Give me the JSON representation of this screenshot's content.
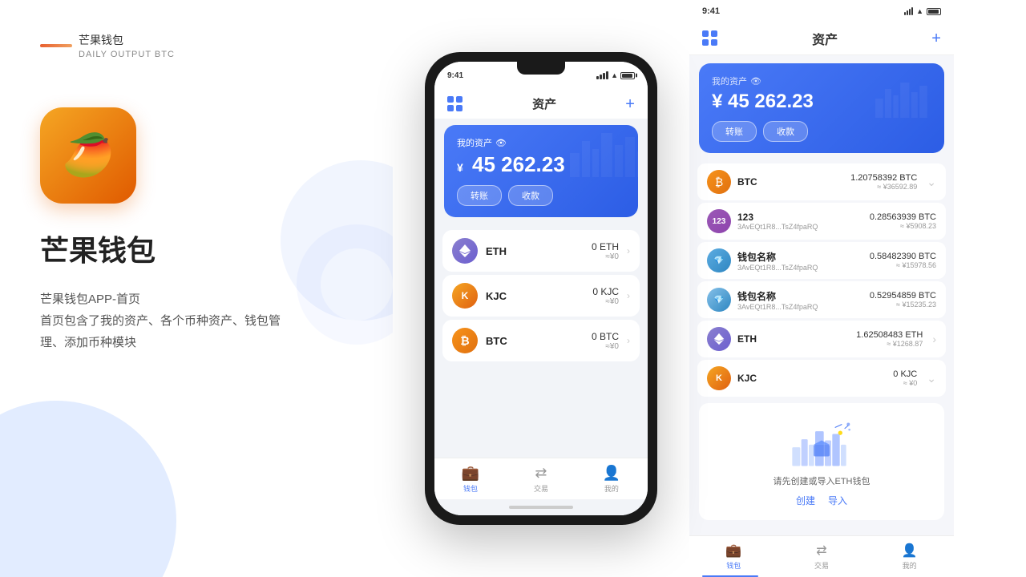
{
  "left": {
    "brand_line": "",
    "brand_name": "芒果钱包",
    "brand_sub": "DAILY OUTPUT BTC",
    "app_title": "芒果钱包",
    "app_desc_1": "芒果钱包APP-首页",
    "app_desc_2": "首页包含了我的资产、各个币种资产、钱包管",
    "app_desc_3": "理、添加币种模块"
  },
  "phone": {
    "status_time": "9:41",
    "header_title": "资产",
    "asset_label": "我的资产",
    "asset_amount": "45 262.23",
    "asset_cny": "¥",
    "btn_transfer": "转账",
    "btn_receive": "收款",
    "coins": [
      {
        "name": "ETH",
        "type": "eth",
        "amount": "0 ETH",
        "cny": "≈¥0",
        "symbol": "⬡"
      },
      {
        "name": "KJC",
        "type": "kjc",
        "amount": "0 KJC",
        "cny": "≈¥0",
        "symbol": "K"
      },
      {
        "name": "BTC",
        "type": "btc",
        "amount": "0 BTC",
        "cny": "≈¥0",
        "symbol": "₿"
      }
    ],
    "nav": [
      {
        "label": "钱包",
        "icon": "👜",
        "active": true
      },
      {
        "label": "交易",
        "icon": "⇄",
        "active": false
      },
      {
        "label": "我的",
        "icon": "👤",
        "active": false
      }
    ]
  },
  "right": {
    "status_time": "9:41",
    "header_title": "资产",
    "asset_label": "我的资产",
    "asset_amount": "45 262.23",
    "asset_cny": "¥",
    "btn_transfer": "转账",
    "btn_receive": "收款",
    "coins": [
      {
        "name": "BTC",
        "type": "btc",
        "amount_main": "1.20758392 BTC",
        "amount_cny": "≈ ¥36592.89",
        "addr": "",
        "has_addr": false
      },
      {
        "name": "123",
        "type": "custom",
        "amount_main": "0.28563939 BTC",
        "amount_cny": "≈ ¥5908.23",
        "addr": "3AvEQt1R8...TsZ4fpaRQ",
        "has_addr": true
      },
      {
        "name": "钱包名称",
        "type": "custom2",
        "amount_main": "0.58482390 BTC",
        "amount_cny": "≈ ¥15978.56",
        "addr": "3AvEQt1R8...TsZ4fpaRQ",
        "has_addr": true
      },
      {
        "name": "钱包名称",
        "type": "custom2",
        "amount_main": "0.52954859 BTC",
        "amount_cny": "≈ ¥15235.23",
        "addr": "3AvEQt1R8...TsZ4fpaRQ",
        "has_addr": true
      },
      {
        "name": "ETH",
        "type": "eth",
        "amount_main": "1.62508483 ETH",
        "amount_cny": "≈ ¥1268.87",
        "addr": "",
        "has_addr": false
      },
      {
        "name": "KJC",
        "type": "kjc",
        "amount_main": "0 KJC",
        "amount_cny": "≈ ¥0",
        "addr": "",
        "has_addr": false
      }
    ],
    "eth_wallet_text": "请先创建或导入ETH钱包",
    "eth_create": "创建",
    "eth_import": "导入",
    "nav": [
      {
        "label": "钱包",
        "active": true
      },
      {
        "label": "交易",
        "active": false
      },
      {
        "label": "我的",
        "active": false
      }
    ]
  },
  "colors": {
    "accent": "#4a7af7",
    "orange": "#f5a623",
    "dark": "#222",
    "muted": "#999"
  }
}
